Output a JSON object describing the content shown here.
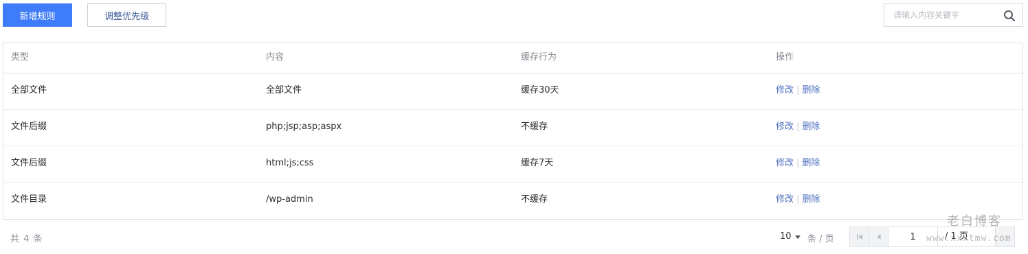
{
  "toolbar": {
    "add_rule_label": "新增规则",
    "adjust_priority_label": "调整优先级"
  },
  "search": {
    "placeholder": "请输入内容关键字",
    "icon": "search-icon"
  },
  "table": {
    "headers": [
      "类型",
      "内容",
      "缓存行为",
      "操作"
    ],
    "rows": [
      {
        "type": "全部文件",
        "content": "全部文件",
        "behavior": "缓存30天",
        "edit": "修改",
        "sep": "|",
        "delete": "删除"
      },
      {
        "type": "文件后缀",
        "content": "php;jsp;asp;aspx",
        "behavior": "不缓存",
        "edit": "修改",
        "sep": "|",
        "delete": "删除"
      },
      {
        "type": "文件后缀",
        "content": "html;js;css",
        "behavior": "缓存7天",
        "edit": "修改",
        "sep": "|",
        "delete": "删除"
      },
      {
        "type": "文件目录",
        "content": "/wp-admin",
        "behavior": "不缓存",
        "edit": "修改",
        "sep": "|",
        "delete": "删除"
      }
    ]
  },
  "footer": {
    "total": "共 4 条",
    "page_size": "10",
    "per_page_unit": "条 / 页",
    "current_page": "1",
    "total_pages": "/ 1 页"
  },
  "watermark": {
    "title": "老白博客",
    "url": "www.xxxtmw.com"
  },
  "colors": {
    "primary": "#3f7cf9",
    "link": "#4d6dbf",
    "border": "#dcdfe4"
  }
}
